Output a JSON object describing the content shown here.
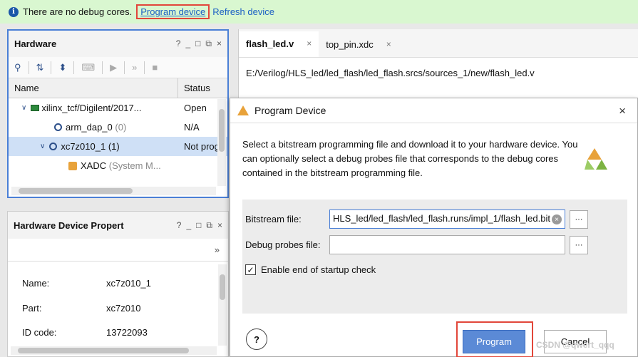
{
  "banner": {
    "message": "There are no debug cores.",
    "program_link": "Program device",
    "refresh_link": "Refresh device"
  },
  "hardware": {
    "title": "Hardware",
    "controls": [
      "?",
      "_",
      "□",
      "⧉",
      "×"
    ],
    "col_name": "Name",
    "col_status": "Status",
    "rows": [
      {
        "name": "xilinx_tcf/Digilent/2017...",
        "status": "Open"
      },
      {
        "name": "arm_dap_0",
        "suffix": "(0)",
        "status": "N/A"
      },
      {
        "name": "xc7z010_1 (1)",
        "status": "Not prog"
      },
      {
        "name": "XADC",
        "suffix": "(System M...",
        "status": ""
      }
    ]
  },
  "properties": {
    "title": "Hardware Device Propert",
    "controls": [
      "?",
      "_",
      "□",
      "⧉",
      "×"
    ],
    "overflow": "»",
    "rows": [
      {
        "key": "Name:",
        "value": "xc7z010_1"
      },
      {
        "key": "Part:",
        "value": "xc7z010"
      },
      {
        "key": "ID code:",
        "value": "13722093"
      }
    ]
  },
  "editor": {
    "tabs": [
      {
        "label": "flash_led.v",
        "close": "×"
      },
      {
        "label": "top_pin.xdc",
        "close": "×"
      }
    ],
    "path": "E:/Verilog/HLS_led/led_flash/led_flash.srcs/sources_1/new/flash_led.v"
  },
  "dialog": {
    "title": "Program Device",
    "close": "×",
    "description": "Select a bitstream programming file and download it to your hardware device. You can optionally select a debug probes file that corresponds to the debug cores contained in the bitstream programming file.",
    "bitstream_label": "Bitstream file:",
    "bitstream_value": "HLS_led/led_flash/led_flash.runs/impl_1/flash_led.bit",
    "probes_label": "Debug probes file:",
    "probes_value": "",
    "browse": "···",
    "checkbox_label": "Enable end of startup check",
    "checkbox_checked": true,
    "help": "?",
    "program_btn": "Program",
    "cancel_btn": "Cancel"
  },
  "watermark": "CSDN @qwert_qqq",
  "colors": {
    "banner_bg": "#d9f7d0",
    "link": "#1a5fc4",
    "highlight_frame": "#e2463a",
    "panel_frame": "#4a7fd6",
    "primary_button": "#5b8ad6",
    "selection": "#cfe0f6"
  }
}
